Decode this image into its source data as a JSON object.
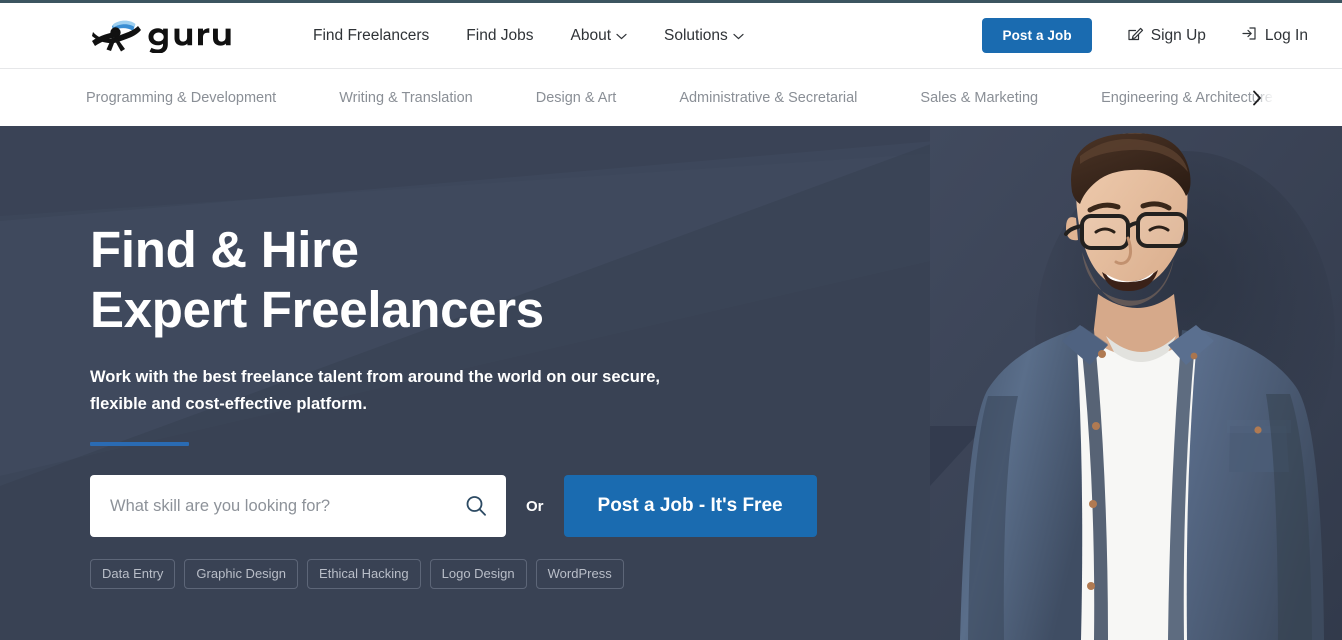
{
  "brand": {
    "name": "guru",
    "logo_icon": "guru-logo"
  },
  "header": {
    "nav": [
      {
        "label": "Find Freelancers",
        "has_caret": false
      },
      {
        "label": "Find Jobs",
        "has_caret": false
      },
      {
        "label": "About",
        "has_caret": true
      },
      {
        "label": "Solutions",
        "has_caret": true
      }
    ],
    "post_job_label": "Post a Job",
    "sign_up_label": "Sign Up",
    "log_in_label": "Log In",
    "sign_up_icon": "pencil-square-icon",
    "log_in_icon": "login-arrow-icon",
    "accent_color": "#1a6bb0"
  },
  "categories": {
    "items": [
      "Programming & Development",
      "Writing & Translation",
      "Design & Art",
      "Administrative & Secretarial",
      "Sales & Marketing",
      "Engineering & Architecture"
    ],
    "next_icon": "chevron-right-icon"
  },
  "hero": {
    "heading": "Find & Hire\nExpert Freelancers",
    "subheading": "Work with the best freelance talent from around the world on our secure,\nflexible and cost-effective platform.",
    "background_color": "#3a4356",
    "divider_color": "#2a6bb3",
    "search": {
      "placeholder": "What skill are you looking for?",
      "value": "",
      "icon": "search-icon"
    },
    "or_label": "Or",
    "cta_label": "Post a Job - It's Free",
    "tags": [
      "Data Entry",
      "Graphic Design",
      "Ethical Hacking",
      "Logo Design",
      "WordPress"
    ],
    "photo_alt": "smiling-man-with-glasses-denim-shirt"
  }
}
